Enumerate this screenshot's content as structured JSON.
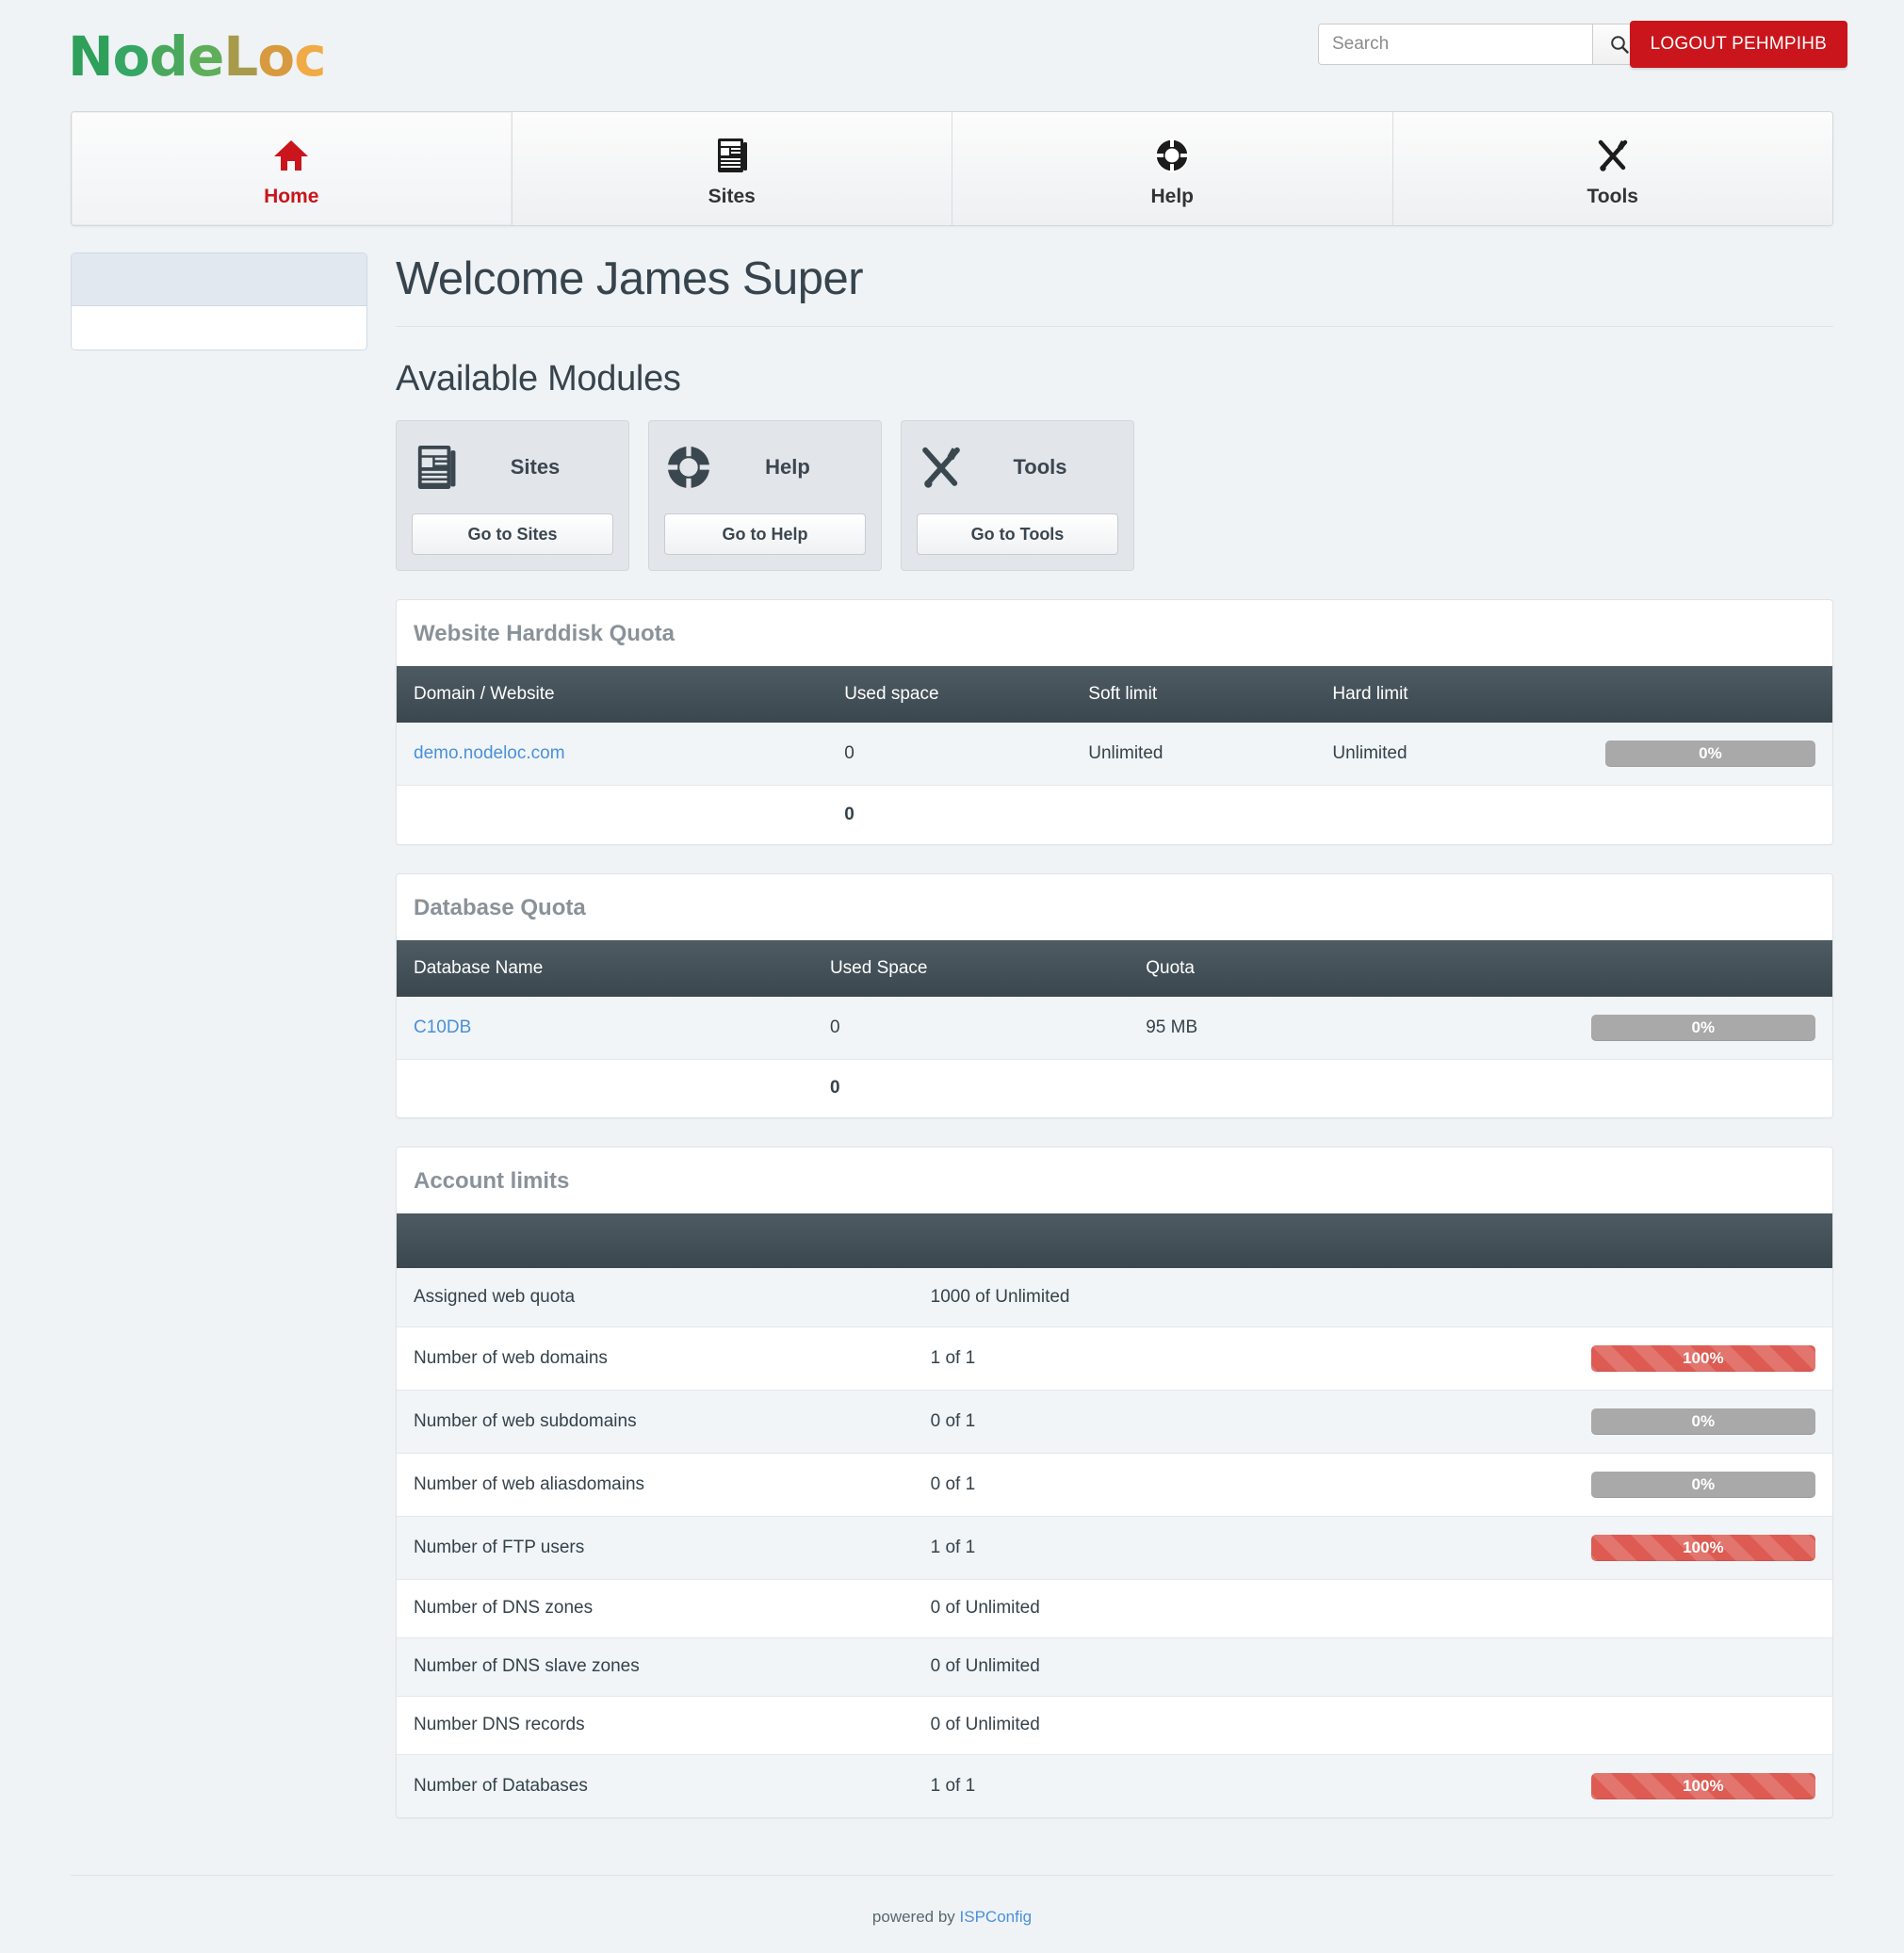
{
  "brand": {
    "name": "NodeLoc",
    "letters": [
      "N",
      "o",
      "d",
      "e",
      "L",
      "o",
      "c"
    ]
  },
  "header": {
    "search": {
      "placeholder": "Search",
      "value": "",
      "button_icon": "search-icon"
    },
    "logout_label": "LOGOUT PEHMPIHB"
  },
  "nav": {
    "tabs": [
      {
        "label": "Home",
        "icon": "home-icon",
        "active": true
      },
      {
        "label": "Sites",
        "icon": "newspaper-icon",
        "active": false
      },
      {
        "label": "Help",
        "icon": "lifering-icon",
        "active": false
      },
      {
        "label": "Tools",
        "icon": "tools-icon",
        "active": false
      }
    ]
  },
  "sidebar": {
    "panel_header": "",
    "panel_body": ""
  },
  "main": {
    "welcome_title": "Welcome James Super",
    "modules_heading": "Available Modules",
    "modules": [
      {
        "title": "Sites",
        "icon": "newspaper-icon",
        "button_label": "Go to Sites"
      },
      {
        "title": "Help",
        "icon": "lifering-icon",
        "button_label": "Go to Help"
      },
      {
        "title": "Tools",
        "icon": "tools-icon",
        "button_label": "Go to Tools"
      }
    ]
  },
  "website_quota": {
    "title": "Website Harddisk Quota",
    "columns": [
      "Domain / Website",
      "Used space",
      "Soft limit",
      "Hard limit",
      ""
    ],
    "rows": [
      {
        "domain": "demo.nodeloc.com",
        "used_space": "0",
        "soft_limit": "Unlimited",
        "hard_limit": "Unlimited",
        "percent_label": "0%",
        "percent": 0,
        "bar_style": "gray"
      }
    ],
    "total": {
      "label": "",
      "used_space": "0"
    }
  },
  "database_quota": {
    "title": "Database Quota",
    "columns": [
      "Database Name",
      "Used Space",
      "Quota",
      ""
    ],
    "rows": [
      {
        "name": "C10DB",
        "used_space": "0",
        "quota": "95 MB",
        "percent_label": "0%",
        "percent": 0,
        "bar_style": "gray"
      }
    ],
    "total": {
      "label": "",
      "used_space": "0"
    }
  },
  "account_limits": {
    "title": "Account limits",
    "columns": [
      "",
      "",
      ""
    ],
    "rows": [
      {
        "label": "Assigned web quota",
        "value": "1000 of Unlimited",
        "percent_label": "",
        "percent": null,
        "bar_style": "none"
      },
      {
        "label": "Number of web domains",
        "value": "1 of 1",
        "percent_label": "100%",
        "percent": 100,
        "bar_style": "red"
      },
      {
        "label": "Number of web subdomains",
        "value": "0 of 1",
        "percent_label": "0%",
        "percent": 0,
        "bar_style": "gray"
      },
      {
        "label": "Number of web aliasdomains",
        "value": "0 of 1",
        "percent_label": "0%",
        "percent": 0,
        "bar_style": "gray"
      },
      {
        "label": "Number of FTP users",
        "value": "1 of 1",
        "percent_label": "100%",
        "percent": 100,
        "bar_style": "red"
      },
      {
        "label": "Number of DNS zones",
        "value": "0 of Unlimited",
        "percent_label": "",
        "percent": null,
        "bar_style": "none"
      },
      {
        "label": "Number of DNS slave zones",
        "value": "0 of Unlimited",
        "percent_label": "",
        "percent": null,
        "bar_style": "none"
      },
      {
        "label": "Number DNS records",
        "value": "0 of Unlimited",
        "percent_label": "",
        "percent": null,
        "bar_style": "none"
      },
      {
        "label": "Number of Databases",
        "value": "1 of 1",
        "percent_label": "100%",
        "percent": 100,
        "bar_style": "red"
      }
    ]
  },
  "footer": {
    "powered_by_text": "powered by",
    "powered_by_link": "ISPConfig"
  },
  "colors": {
    "page_background": "#eff3f6",
    "accent_red": "#c9151b",
    "table_header": "#3b474e",
    "link_blue": "#4a90d9",
    "bar_gray": "#a9a9a9",
    "bar_red": "#dd5b52"
  }
}
